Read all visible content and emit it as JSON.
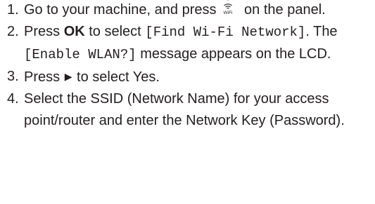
{
  "steps": [
    {
      "number": "1.",
      "text_before_icon": "Go to your machine, and press",
      "icon": "wifi-button-icon",
      "icon_label": "WiFi",
      "text_after_icon": " on the panel."
    },
    {
      "number": "2.",
      "text_press": "Press ",
      "ok_label": "OK",
      "text_to_select": " to select ",
      "menu_item": "[Find Wi-Fi Network]",
      "text_period": ". The ",
      "message": "[Enable WLAN?]",
      "text_after_message": " message appears on the LCD."
    },
    {
      "number": "3.",
      "text_press": "Press ",
      "icon": "right-arrow-icon",
      "arrow_glyph": "▶",
      "text_after_icon": " to select Yes."
    },
    {
      "number": "4.",
      "text": "Select the SSID (Network Name) for your access point/router and enter the Network Key (Password)."
    }
  ]
}
